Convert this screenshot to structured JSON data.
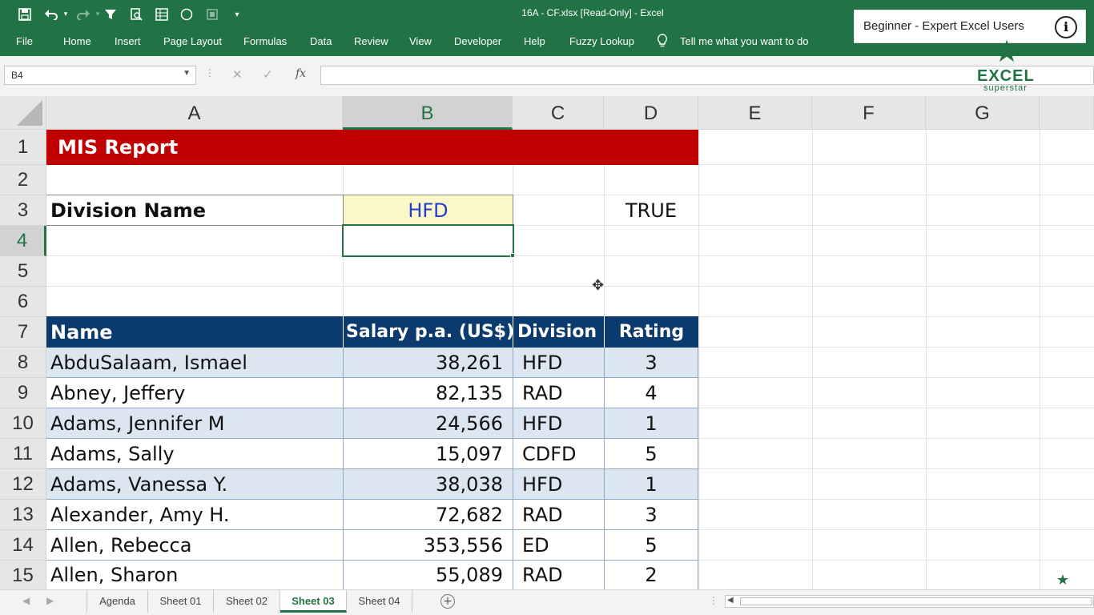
{
  "window": {
    "title": "16A - CF.xlsx  [Read-Only]  -  Excel"
  },
  "ribbon": {
    "tabs": [
      "File",
      "Home",
      "Insert",
      "Page Layout",
      "Formulas",
      "Data",
      "Review",
      "View",
      "Developer",
      "Help",
      "Fuzzy Lookup"
    ],
    "tell_me": "Tell me what you want to do"
  },
  "overlay": {
    "text": "Beginner - Expert Excel Users",
    "info_icon": "i"
  },
  "formula_bar": {
    "name_box": "B4",
    "cancel": "✕",
    "enter": "✓",
    "fx": "fx",
    "formula": ""
  },
  "logo": {
    "text": "EXCEL",
    "sub": "superstar"
  },
  "columns": [
    "A",
    "B",
    "C",
    "D",
    "E",
    "F",
    "G"
  ],
  "rows": [
    "1",
    "2",
    "3",
    "4",
    "5",
    "6",
    "7",
    "8",
    "9",
    "10",
    "11",
    "12",
    "13",
    "14",
    "15"
  ],
  "cells": {
    "a1": "MIS Report",
    "a3": "Division Name",
    "b3": "HFD",
    "d3": "TRUE"
  },
  "table": {
    "headers": [
      "Name",
      "Salary p.a. (US$)",
      "Division",
      "Rating"
    ],
    "rows": [
      {
        "name": "AbduSalaam, Ismael",
        "salary": "38,261",
        "division": "HFD",
        "rating": "3"
      },
      {
        "name": "Abney, Jeffery",
        "salary": "82,135",
        "division": "RAD",
        "rating": "4"
      },
      {
        "name": "Adams, Jennifer M",
        "salary": "24,566",
        "division": "HFD",
        "rating": "1"
      },
      {
        "name": "Adams, Sally",
        "salary": "15,097",
        "division": "CDFD",
        "rating": "5"
      },
      {
        "name": "Adams, Vanessa Y.",
        "salary": "38,038",
        "division": "HFD",
        "rating": "1"
      },
      {
        "name": "Alexander, Amy H.",
        "salary": "72,682",
        "division": "RAD",
        "rating": "3"
      },
      {
        "name": "Allen, Rebecca",
        "salary": "353,556",
        "division": "ED",
        "rating": "5"
      },
      {
        "name": "Allen, Sharon",
        "salary": "55,089",
        "division": "RAD",
        "rating": "2"
      }
    ]
  },
  "sheets": [
    {
      "label": "Agenda",
      "active": false
    },
    {
      "label": "Sheet 01",
      "active": false
    },
    {
      "label": "Sheet 02",
      "active": false
    },
    {
      "label": "Sheet 03",
      "active": true
    },
    {
      "label": "Sheet 04",
      "active": false
    }
  ],
  "colors": {
    "excel_green": "#217346",
    "title_red": "#c00000",
    "header_navy": "#0b3a6e",
    "band_blue": "#dce6f1",
    "input_yellow": "#fbf7c9",
    "hfd_blue": "#1f3fcf"
  },
  "icons": [
    "save-icon",
    "undo-icon",
    "redo-icon",
    "filter-icon",
    "print-preview-icon",
    "table-icon",
    "circle-icon",
    "macro-icon",
    "customize-qat-icon",
    "lightbulb-icon",
    "info-icon",
    "add-sheet-icon",
    "move-cursor-icon"
  ]
}
